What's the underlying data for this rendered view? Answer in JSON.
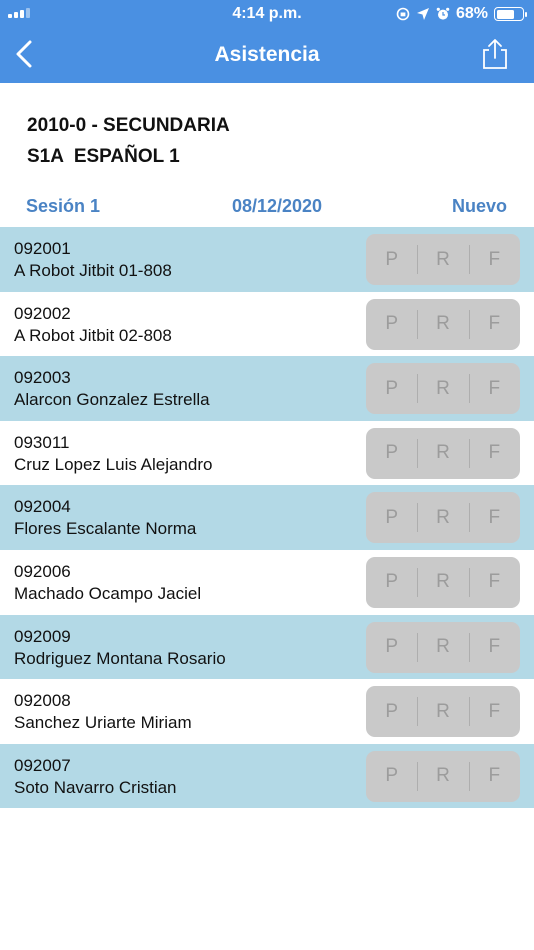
{
  "status_bar": {
    "time": "4:14 p.m.",
    "battery": "68%",
    "battery_level": 0.68,
    "icons": [
      "signal-icon",
      "lock-rotation-icon",
      "location-icon",
      "alarm-icon",
      "battery-icon"
    ]
  },
  "nav": {
    "title": "Asistencia",
    "back_icon": "chevron-left-icon",
    "share_icon": "share-icon"
  },
  "course": {
    "line1": "2010-0 - SECUNDARIA",
    "line2": "S1A  ESPAÑOL 1"
  },
  "session": {
    "label": "Sesión 1",
    "date": "08/12/2020",
    "new_label": "Nuevo"
  },
  "colors": {
    "header": "#4a90e2",
    "accent": "#4a83c4",
    "row_alt": "#b3d9e6",
    "segment": "#c9c9c9"
  },
  "options": [
    "P",
    "R",
    "F"
  ],
  "students": [
    {
      "id": "092001",
      "name": "A Robot Jitbit 01-808"
    },
    {
      "id": "092002",
      "name": "A Robot Jitbit 02-808"
    },
    {
      "id": "092003",
      "name": "Alarcon Gonzalez Estrella"
    },
    {
      "id": "093011",
      "name": "Cruz Lopez Luis Alejandro"
    },
    {
      "id": "092004",
      "name": "Flores Escalante Norma"
    },
    {
      "id": "092006",
      "name": "Machado Ocampo Jaciel"
    },
    {
      "id": "092009",
      "name": "Rodriguez Montana Rosario"
    },
    {
      "id": "092008",
      "name": "Sanchez Uriarte Miriam"
    },
    {
      "id": "092007",
      "name": "Soto Navarro Cristian"
    }
  ]
}
